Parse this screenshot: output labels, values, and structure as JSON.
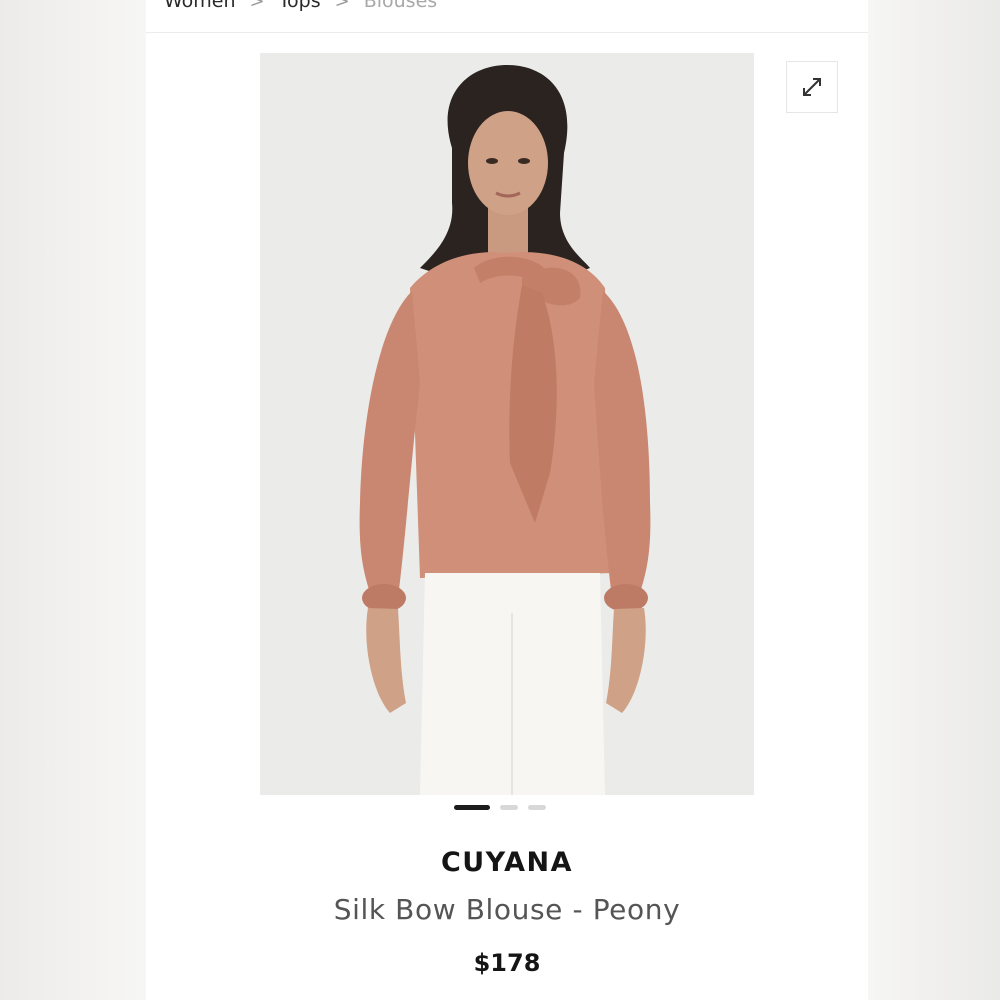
{
  "breadcrumb": {
    "items": [
      "Women",
      "Tops",
      "Blouses"
    ]
  },
  "product": {
    "brand": "CUYANA",
    "name": "Silk Bow Blouse - Peony",
    "price": "$178",
    "image_alt": "Model wearing peony silk bow blouse with white pants"
  },
  "gallery": {
    "image_count": 3,
    "active_index": 0
  },
  "icons": {
    "expand": "expand-arrows-icon",
    "breadcrumb_separator": "chevron-right-icon"
  },
  "colors": {
    "blouse": "#d08f78",
    "pants": "#f7f6f3",
    "hair": "#2a2320",
    "skin": "#c99a80",
    "photo_bg": "#ebebea",
    "active_dot": "#1c1c1c"
  }
}
